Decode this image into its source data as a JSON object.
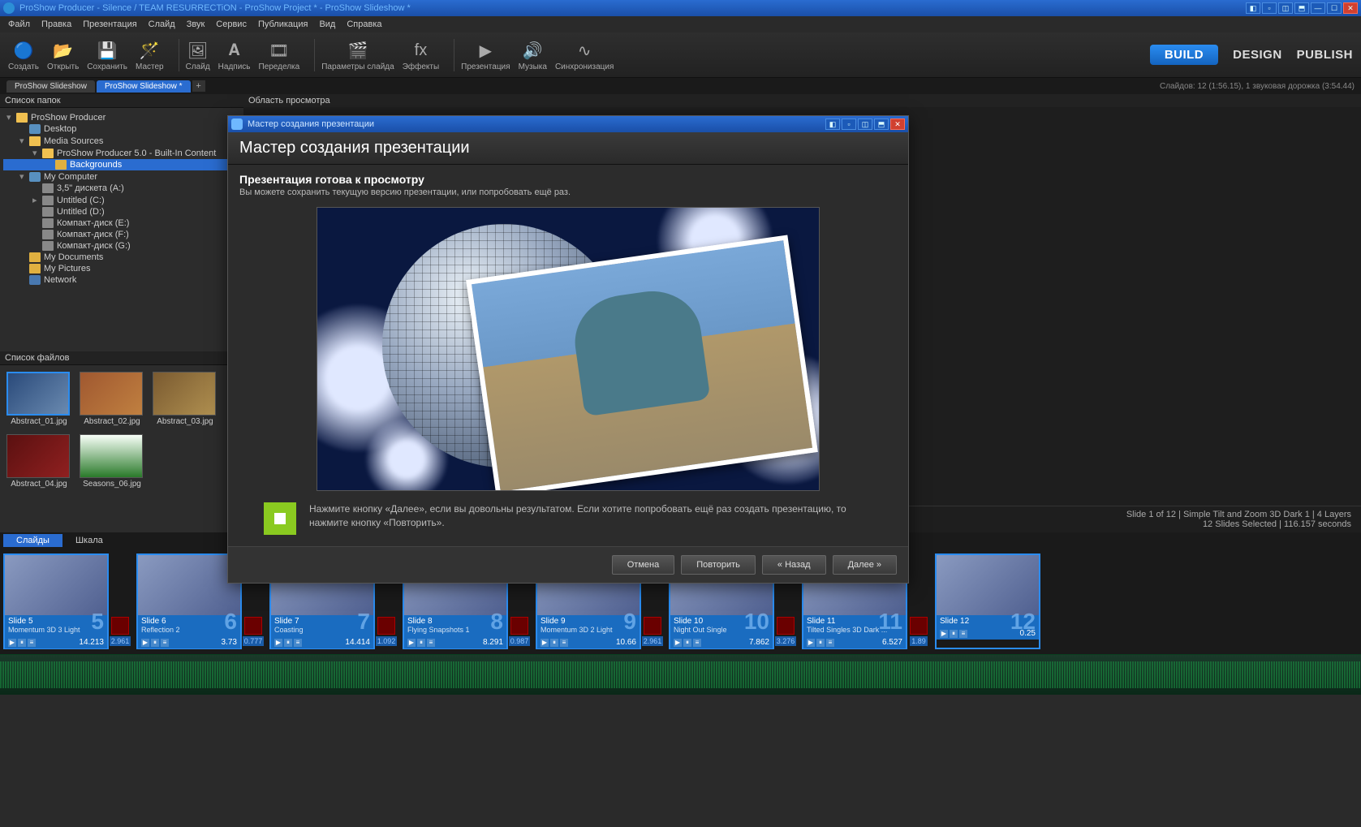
{
  "titlebar": {
    "text": "ProShow Producer - Silence / TEAM RESURRECTiON - ProShow Project * - ProShow Slideshow *"
  },
  "menu": [
    "Файл",
    "Правка",
    "Презентация",
    "Слайд",
    "Звук",
    "Сервис",
    "Публикация",
    "Вид",
    "Справка"
  ],
  "toolbar": [
    {
      "icon": "🔵",
      "label": "Создать"
    },
    {
      "icon": "📂",
      "label": "Открыть"
    },
    {
      "icon": "💾",
      "label": "Сохранить"
    },
    {
      "icon": "🪄",
      "label": "Мастер"
    },
    {
      "div": true
    },
    {
      "icon": "🖼",
      "label": "Слайд"
    },
    {
      "icon": "𝐀",
      "label": "Надпись"
    },
    {
      "icon": "🎞",
      "label": "Переделка"
    },
    {
      "div": true
    },
    {
      "icon": "🎬",
      "label": "Параметры слайда"
    },
    {
      "icon": "fx",
      "label": "Эффекты"
    },
    {
      "div": true
    },
    {
      "icon": "▶",
      "label": "Презентация"
    },
    {
      "icon": "🔊",
      "label": "Музыка"
    },
    {
      "icon": "∿",
      "label": "Синхронизация"
    }
  ],
  "modes": {
    "build": "BUILD",
    "design": "DESIGN",
    "publish": "PUBLISH"
  },
  "tabs": {
    "t1": "ProShow Slideshow",
    "t2": "ProShow Slideshow *"
  },
  "statusline": "Слайдов: 12 (1:56.15), 1 звуковая дорожка (3:54.44)",
  "panels": {
    "folders": "Список папок",
    "files": "Список файлов",
    "preview": "Область просмотра"
  },
  "tree": [
    {
      "d": 0,
      "tg": "▾",
      "ic": "fldo",
      "t": "ProShow Producer"
    },
    {
      "d": 1,
      "tg": "",
      "ic": "dsk",
      "t": "Desktop"
    },
    {
      "d": 1,
      "tg": "▾",
      "ic": "fldo",
      "t": "Media Sources"
    },
    {
      "d": 2,
      "tg": "▾",
      "ic": "fldo",
      "t": "ProShow Producer 5.0 - Built-In Content"
    },
    {
      "d": 3,
      "tg": "",
      "ic": "fld",
      "t": "Backgrounds",
      "sel": true
    },
    {
      "d": 1,
      "tg": "▾",
      "ic": "dsk",
      "t": "My Computer"
    },
    {
      "d": 2,
      "tg": "",
      "ic": "drv",
      "t": "3,5\" дискета (A:)"
    },
    {
      "d": 2,
      "tg": "▸",
      "ic": "drv",
      "t": "Untitled (C:)"
    },
    {
      "d": 2,
      "tg": "",
      "ic": "drv",
      "t": "Untitled (D:)"
    },
    {
      "d": 2,
      "tg": "",
      "ic": "drv",
      "t": "Компакт-диск (E:)"
    },
    {
      "d": 2,
      "tg": "",
      "ic": "drv",
      "t": "Компакт-диск (F:)"
    },
    {
      "d": 2,
      "tg": "",
      "ic": "drv",
      "t": "Компакт-диск (G:)"
    },
    {
      "d": 1,
      "tg": "",
      "ic": "fld",
      "t": "My Documents"
    },
    {
      "d": 1,
      "tg": "",
      "ic": "fld",
      "t": "My Pictures"
    },
    {
      "d": 1,
      "tg": "",
      "ic": "net",
      "t": "Network"
    }
  ],
  "files": [
    {
      "name": "Abstract_01.jpg",
      "bg": "linear-gradient(135deg,#2a4a7a,#6a8ab0)",
      "sel": true
    },
    {
      "name": "Abstract_02.jpg",
      "bg": "linear-gradient(135deg,#a05830,#c08040)"
    },
    {
      "name": "Abstract_03.jpg",
      "bg": "linear-gradient(135deg,#7a5a30,#b09050)"
    },
    {
      "name": "Abstract_04.jpg",
      "bg": "linear-gradient(135deg,#5a1010,#902020)"
    },
    {
      "name": "Seasons_06.jpg",
      "bg": "linear-gradient(#f8fff8,#2a7a2a)"
    }
  ],
  "infoline1": "Slide 1 of 12  |  Simple Tilt and Zoom 3D Dark 1  |  4 Layers",
  "infoline2": "12 Slides Selected  |  116.157 seconds",
  "tltabs": {
    "slides": "Слайды",
    "scale": "Шкала"
  },
  "slides": [
    {
      "n": 5,
      "title": "Slide 5",
      "sub": "Momentum 3D 3 Light",
      "dur": "14.213",
      "trans": "2.961"
    },
    {
      "n": 6,
      "title": "Slide 6",
      "sub": "Reflection 2",
      "dur": "3.73",
      "trans": "0.777"
    },
    {
      "n": 7,
      "title": "Slide 7",
      "sub": "Coasting",
      "dur": "14.414",
      "trans": "1.092"
    },
    {
      "n": 8,
      "title": "Slide 8",
      "sub": "Flying Snapshots 1",
      "dur": "8.291",
      "trans": "0.987"
    },
    {
      "n": 9,
      "title": "Slide 9",
      "sub": "Momentum 3D 2 Light",
      "dur": "10.66",
      "trans": "2.961"
    },
    {
      "n": 10,
      "title": "Slide 10",
      "sub": "Night Out Single",
      "dur": "7.862",
      "trans": "3.276"
    },
    {
      "n": 11,
      "title": "Slide 11",
      "sub": "Tilted Singles 3D Dark ...",
      "dur": "6.527",
      "trans": "1.89"
    },
    {
      "n": 12,
      "title": "Slide 12",
      "sub": "",
      "dur": "0.25",
      "trans": ""
    }
  ],
  "dialog": {
    "title": "Мастер создания презентации",
    "heading": "Мастер создания презентации",
    "sub": "Презентация готова к просмотру",
    "desc": "Вы можете сохранить текущую версию презентации, или попробовать ещё раз.",
    "hint": "Нажмите кнопку «Далее», если вы довольны результатом. Если хотите попробовать ещё раз создать презентацию, то нажмите кнопку «Повторить».",
    "btns": {
      "cancel": "Отмена",
      "repeat": "Повторить",
      "back": "« Назад",
      "next": "Далее »"
    }
  }
}
